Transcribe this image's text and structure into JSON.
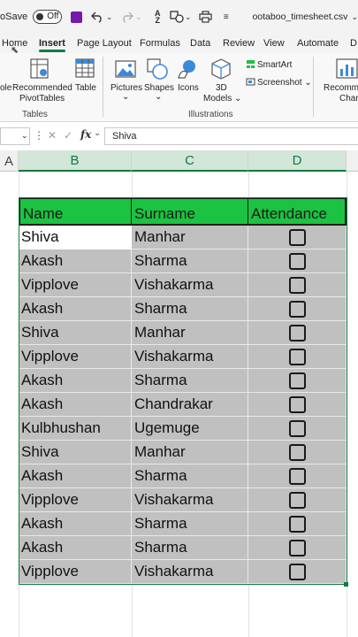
{
  "titlebar": {
    "autosave_label": "oSave",
    "toggle_state": "Off",
    "filename": "ootaboo_timesheet.csv",
    "filename_caret": "⌄"
  },
  "tabs": [
    "Home",
    "Insert",
    "Page Layout",
    "Formulas",
    "Data",
    "Review",
    "View",
    "Automate",
    "D"
  ],
  "active_tab": "Insert",
  "ribbon": {
    "tables_group": {
      "label": "Tables",
      "items": [
        {
          "name": "pivot",
          "label_lines": [
            "ole",
            ""
          ]
        },
        {
          "name": "recommended-pivottables",
          "label_lines": [
            "Recommended",
            "PivotTables"
          ]
        },
        {
          "name": "table",
          "label_lines": [
            "Table",
            ""
          ]
        }
      ]
    },
    "illustrations_group": {
      "label": "Illustrations",
      "items": [
        {
          "name": "pictures",
          "label_lines": [
            "Pictures",
            "⌄"
          ]
        },
        {
          "name": "shapes",
          "label_lines": [
            "Shapes",
            "⌄"
          ]
        },
        {
          "name": "icons",
          "label_lines": [
            "Icons",
            ""
          ]
        },
        {
          "name": "3d-models",
          "label_lines": [
            "3D",
            "Models ⌄"
          ]
        }
      ],
      "small_items": [
        "SmartArt",
        "Screenshot ⌄"
      ]
    },
    "right_items": [
      {
        "name": "recommended-charts",
        "label_lines": [
          "Recomme",
          "Chart"
        ]
      }
    ]
  },
  "formula_bar": {
    "fx": "fx",
    "value": "Shiva"
  },
  "columns": [
    "A",
    "B",
    "C",
    "D"
  ],
  "selected_columns": [
    "B",
    "C",
    "D"
  ],
  "table": {
    "headers": [
      "Name",
      "Surname",
      "Attendance"
    ],
    "rows": [
      {
        "name": "Shiva",
        "surname": "Manhar",
        "attendance": false
      },
      {
        "name": "Akash",
        "surname": "Sharma",
        "attendance": false
      },
      {
        "name": "Vipplove",
        "surname": "Vishakarma",
        "attendance": false
      },
      {
        "name": "Akash",
        "surname": "Sharma",
        "attendance": false
      },
      {
        "name": "Shiva",
        "surname": "Manhar",
        "attendance": false
      },
      {
        "name": "Vipplove",
        "surname": "Vishakarma",
        "attendance": false
      },
      {
        "name": "Akash",
        "surname": "Sharma",
        "attendance": false
      },
      {
        "name": "Akash",
        "surname": "Chandrakar",
        "attendance": false
      },
      {
        "name": "Kulbhushan",
        "surname": "Ugemuge",
        "attendance": false
      },
      {
        "name": "Shiva",
        "surname": "Manhar",
        "attendance": false
      },
      {
        "name": "Akash",
        "surname": "Sharma",
        "attendance": false
      },
      {
        "name": "Vipplove",
        "surname": "Vishakarma",
        "attendance": false
      },
      {
        "name": "Akash",
        "surname": "Sharma",
        "attendance": false
      },
      {
        "name": "Akash",
        "surname": "Sharma",
        "attendance": false
      },
      {
        "name": "Vipplove",
        "surname": "Vishakarma",
        "attendance": false
      }
    ]
  },
  "colors": {
    "header_fill": "#1cc241",
    "data_fill": "#c0c0c0",
    "accent": "#107c41"
  }
}
